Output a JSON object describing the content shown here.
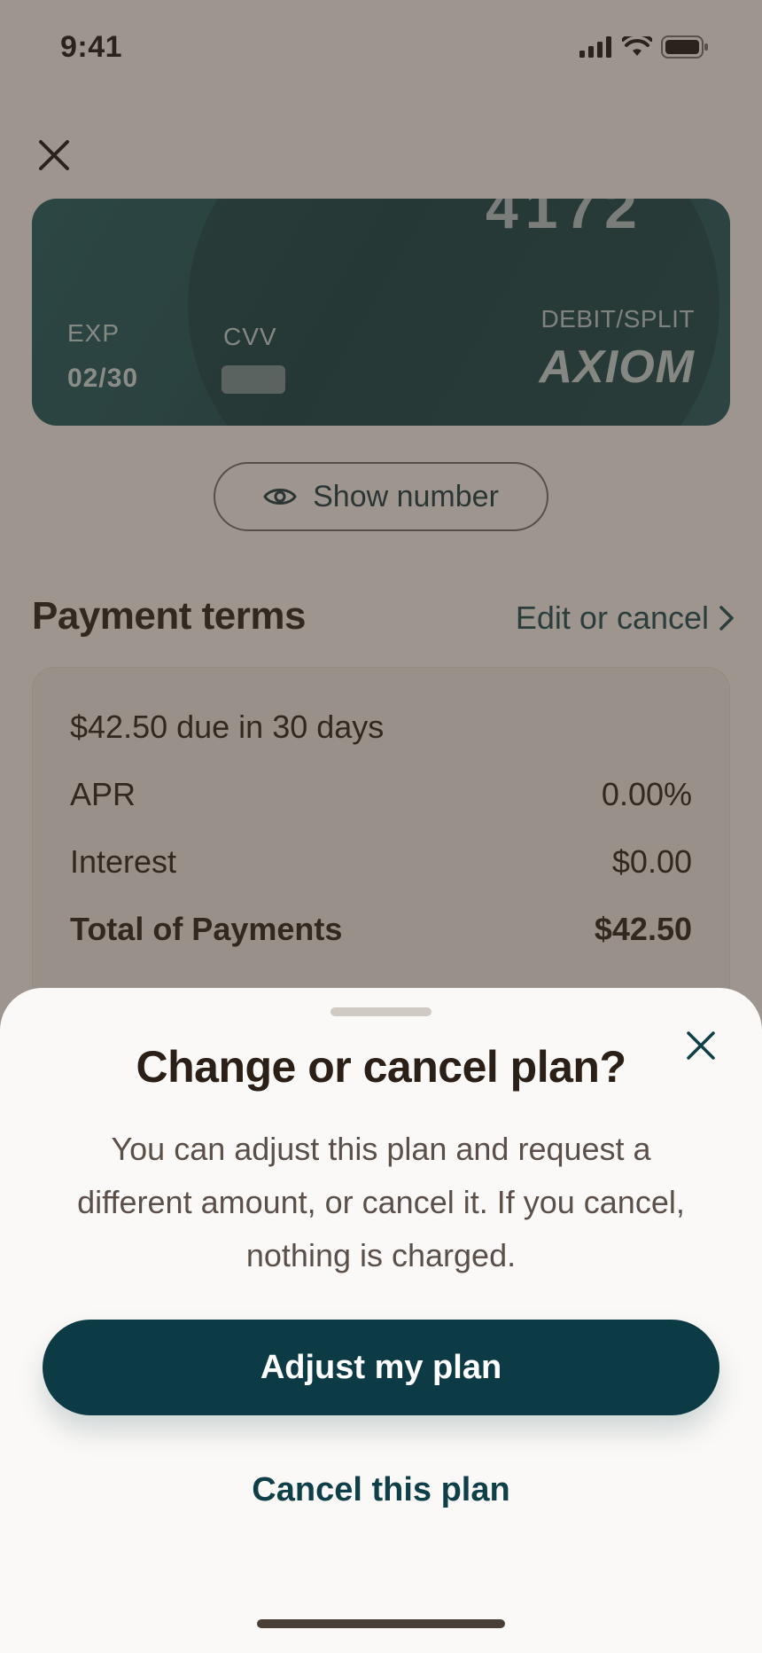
{
  "status_bar": {
    "time": "9:41"
  },
  "card": {
    "last4": "4172",
    "exp_label": "EXP",
    "exp_value": "02/30",
    "cvv_label": "CVV",
    "card_type": "DEBIT/SPLIT",
    "brand": "AXIOM"
  },
  "show_number": {
    "label": "Show number"
  },
  "payment_terms": {
    "title": "Payment terms",
    "edit_label": "Edit or cancel",
    "due_text": "$42.50 due in 30 days",
    "rows": [
      {
        "label": "APR",
        "value": "0.00%"
      },
      {
        "label": "Interest",
        "value": "$0.00"
      },
      {
        "label": "Total of Payments",
        "value": "$42.50"
      }
    ]
  },
  "sheet": {
    "title": "Change or cancel plan?",
    "body": "You can adjust this plan and request a different amount, or cancel it. If you cancel, nothing is charged.",
    "primary_label": "Adjust my plan",
    "secondary_label": "Cancel this plan"
  },
  "colors": {
    "primary": "#0d3b45",
    "card": "#1f5a5e",
    "background": "#f4efe9",
    "sheet": "#fbf9f7"
  }
}
